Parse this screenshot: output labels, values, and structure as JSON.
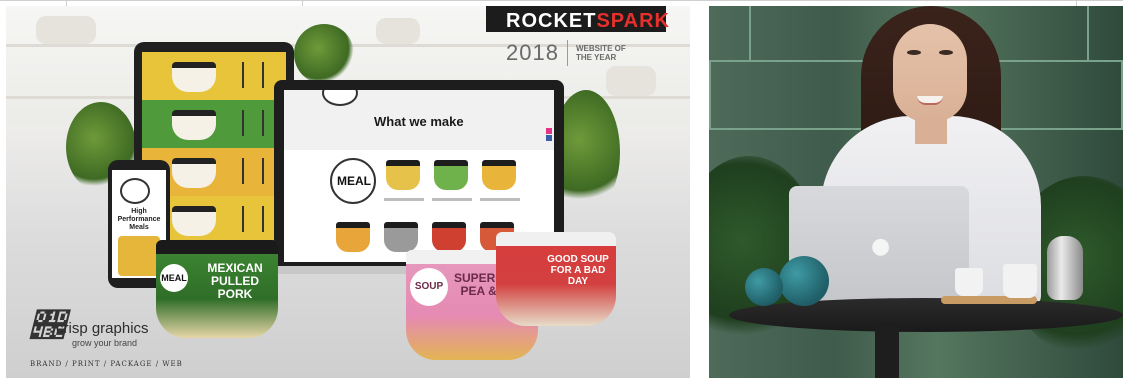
{
  "promo": {
    "award_brand_part1": "ROCKET",
    "award_brand_part2": "SPARK",
    "award_year": "2018",
    "award_title": "WEBSITE OF THE YEAR",
    "laptop_heading": "What we make",
    "laptop_badge": "MEAL",
    "phone_text": "High Performance Meals",
    "product_mexican": "MEXICAN PULLED PORK",
    "product_meal_badge": "MEAL",
    "product_soup_badge": "SOUP",
    "product_supergrain": "SUPERGRAIN PEA & HAM",
    "product_goodsoup": "GOOD SOUP FOR A BAD DAY",
    "company_name": "crisp graphics",
    "company_tagline": "grow your brand",
    "company_services": "BRAND / PRINT / PACKAGE / WEB"
  },
  "colors": {
    "accent_red": "#e5302c",
    "yellow_band": "#e8c43a",
    "green_band": "#4f9a3a",
    "laptop_bg": "#ffffff"
  },
  "icons": [
    "apple-logo-icon",
    "social-share-icon"
  ]
}
